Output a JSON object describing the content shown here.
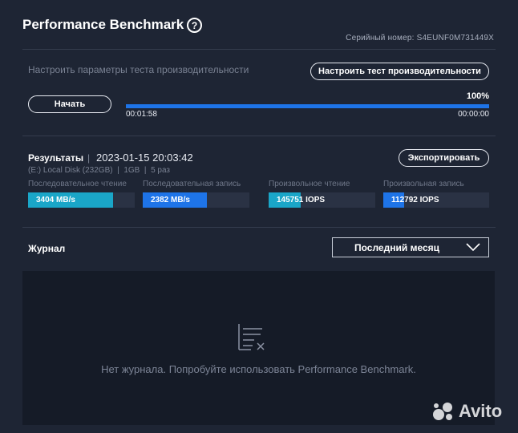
{
  "header": {
    "title": "Performance Benchmark",
    "help_icon": "?",
    "serial": "Серийный номер: S4EUNF0M731449X"
  },
  "settings": {
    "hint": "Настроить параметры теста производительности",
    "configure_label": "Настроить тест производительности",
    "start_label": "Начать"
  },
  "progress": {
    "percent_label": "100%",
    "fraction": 1.0,
    "elapsed": "00:01:58",
    "remaining": "00:00:00",
    "color": "#1e74e8"
  },
  "results": {
    "label": "Результаты",
    "separator": "|",
    "date": "2023-01-15 20:03:42",
    "disk": "(E:) Local Disk (232GB)",
    "size": "1GB",
    "runs": "5 раз",
    "export_label": "Экспортировать",
    "metrics": [
      {
        "label": "Последовательное чтение",
        "value": "3404 MB/s",
        "fraction": 0.8,
        "color": "#1aa6c8"
      },
      {
        "label": "Последовательная запись",
        "value": "2382 MB/s",
        "fraction": 0.6,
        "color": "#1e74e8"
      },
      {
        "label": "Произвольное чтение",
        "value": "145751 IOPS",
        "fraction": 0.3,
        "color": "#1aa6c8"
      },
      {
        "label": "Произвольная запись",
        "value": "112792 IOPS",
        "fraction": 0.2,
        "color": "#1e74e8"
      }
    ]
  },
  "journal": {
    "label": "Журнал",
    "period": "Последний месяц",
    "empty_text": "Нет журнала. Попробуйте использовать Performance Benchmark.",
    "empty_icon": "log-empty-icon"
  },
  "watermark": {
    "text": "Avito"
  }
}
